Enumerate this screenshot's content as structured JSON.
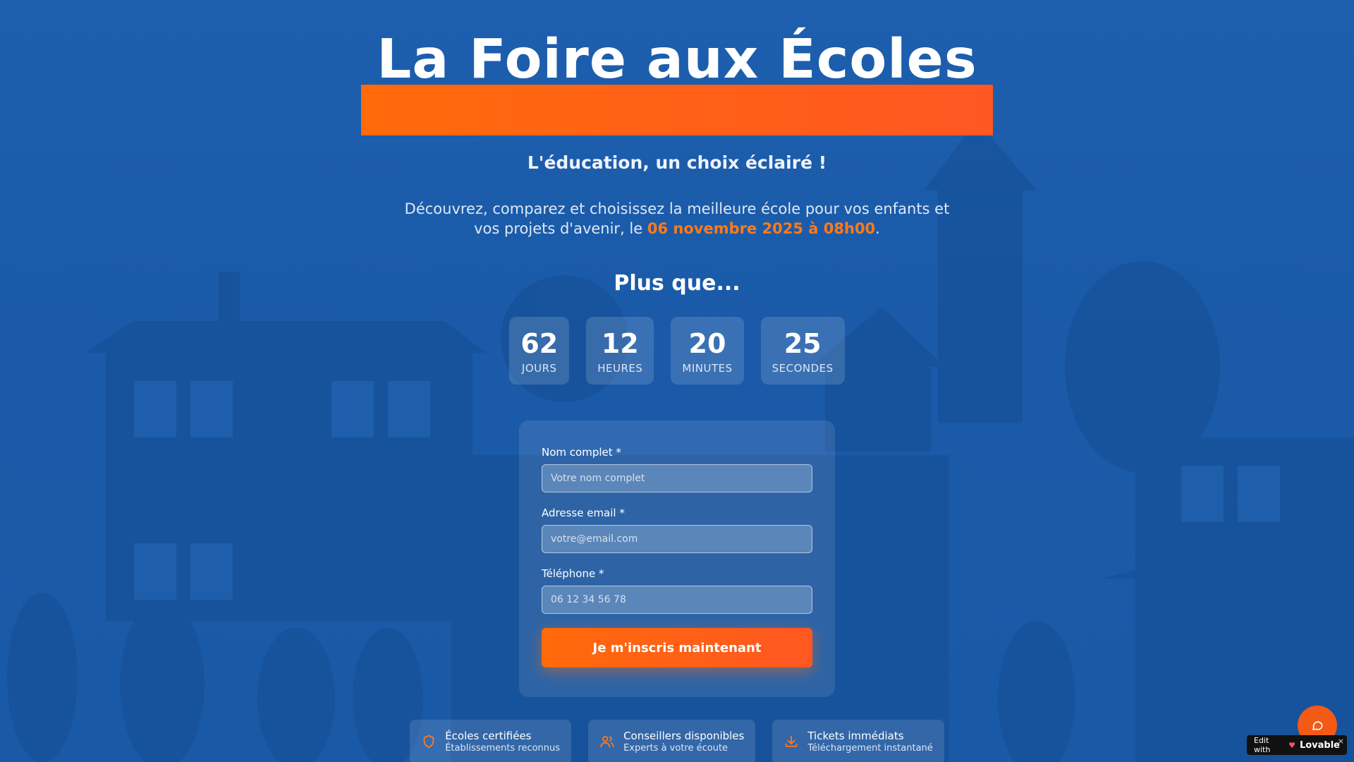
{
  "hero": {
    "title": "La Foire aux Écoles",
    "tagline": "L'éducation, un choix éclairé !",
    "description_before": "Découvrez, comparez et choisissez la meilleure école pour vos enfants et vos projets d'avenir, le ",
    "description_date": "06 novembre 2025 à 08h00",
    "description_after": ".",
    "countdown_heading": "Plus que..."
  },
  "countdown": [
    {
      "value": "62",
      "label": "JOURS"
    },
    {
      "value": "12",
      "label": "HEURES"
    },
    {
      "value": "20",
      "label": "MINUTES"
    },
    {
      "value": "25",
      "label": "SECONDES"
    }
  ],
  "form": {
    "name_label": "Nom complet *",
    "name_placeholder": "Votre nom complet",
    "email_label": "Adresse email *",
    "email_placeholder": "votre@email.com",
    "phone_label": "Téléphone *",
    "phone_placeholder": "06 12 34 56 78",
    "submit_label": "Je m'inscris maintenant"
  },
  "features": [
    {
      "icon": "shield-icon",
      "title": "Écoles certifiées",
      "subtitle": "Établissements reconnus"
    },
    {
      "icon": "users-icon",
      "title": "Conseillers disponibles",
      "subtitle": "Experts à votre écoute"
    },
    {
      "icon": "download-icon",
      "title": "Tickets immédiats",
      "subtitle": "Téléchargement instantané"
    }
  ],
  "badge": {
    "edit_with": "Edit with",
    "brand": "Lovable",
    "close": "×"
  },
  "colors": {
    "accent": "#ff6a0a",
    "background": "#1d5fae"
  }
}
